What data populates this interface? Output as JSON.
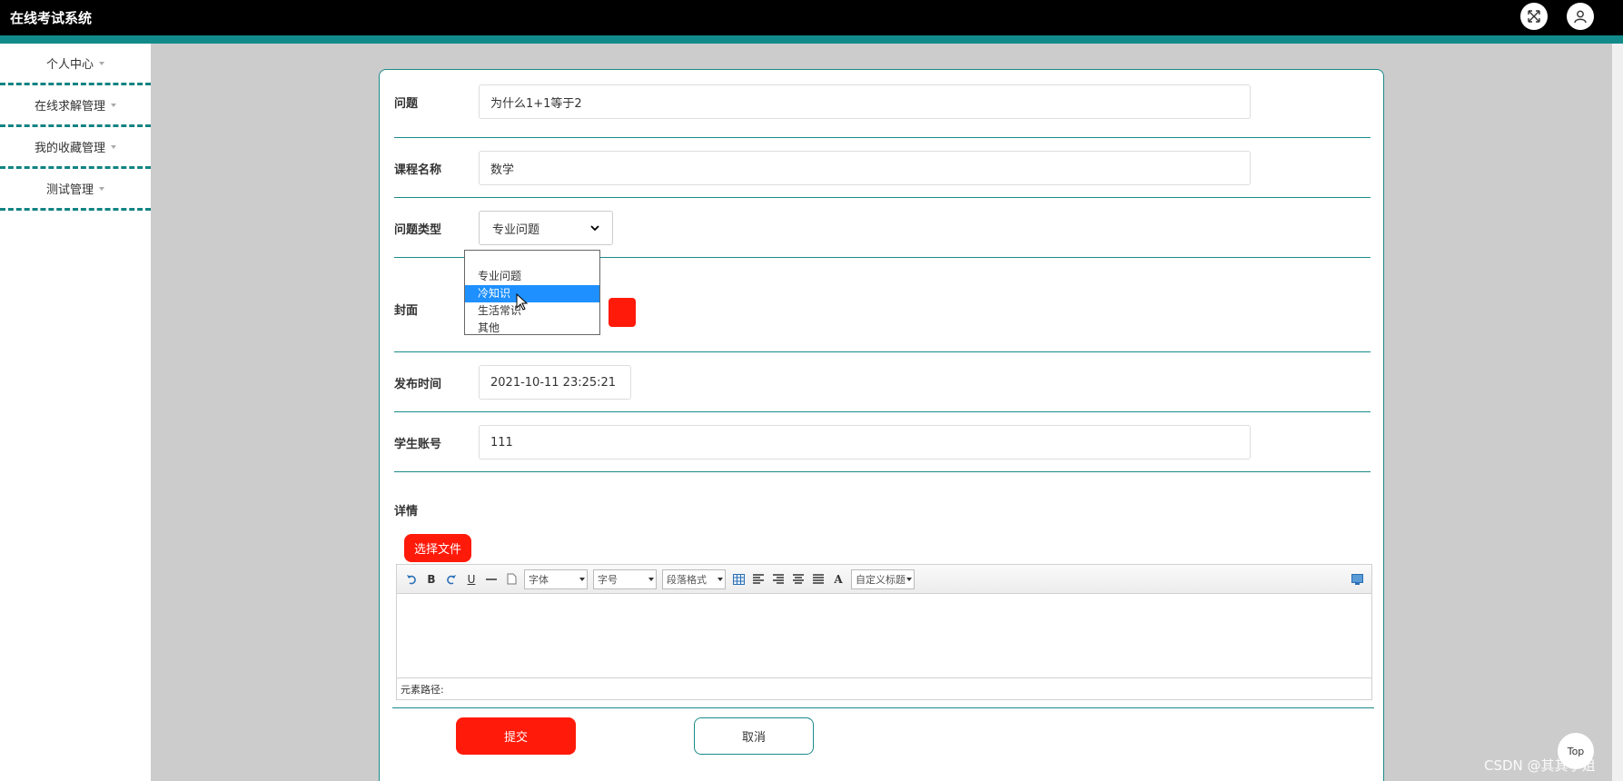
{
  "app": {
    "title": "在线考试系统"
  },
  "sidebar": {
    "items": [
      {
        "label": "个人中心"
      },
      {
        "label": "在线求解管理"
      },
      {
        "label": "我的收藏管理"
      },
      {
        "label": "测试管理"
      }
    ]
  },
  "form": {
    "question": {
      "label": "问题",
      "value": "为什么1+1等于2"
    },
    "course": {
      "label": "课程名称",
      "value": "数学"
    },
    "type": {
      "label": "问题类型",
      "value": "专业问题",
      "options": [
        "专业问题",
        "冷知识",
        "生活常识",
        "其他"
      ],
      "highlighted": "冷知识"
    },
    "cover": {
      "label": "封面"
    },
    "publish_time": {
      "label": "发布时间",
      "value": "2021-10-11 23:25:21"
    },
    "student_account": {
      "label": "学生账号",
      "value": "111"
    },
    "detail": {
      "label": "详情"
    },
    "choose_file_label": "选择文件",
    "editor": {
      "font_placeholder": "字体",
      "size_placeholder": "字号",
      "paragraph_placeholder": "段落格式",
      "custom_title_placeholder": "自定义标题",
      "path_label": "元素路径:"
    },
    "submit_label": "提交",
    "cancel_label": "取消"
  },
  "misc": {
    "top_label": "Top",
    "watermark": "CSDN @其其学姐"
  },
  "colors": {
    "accent": "#138a8a",
    "danger": "#ff1a0a",
    "highlight": "#1e90ff"
  }
}
